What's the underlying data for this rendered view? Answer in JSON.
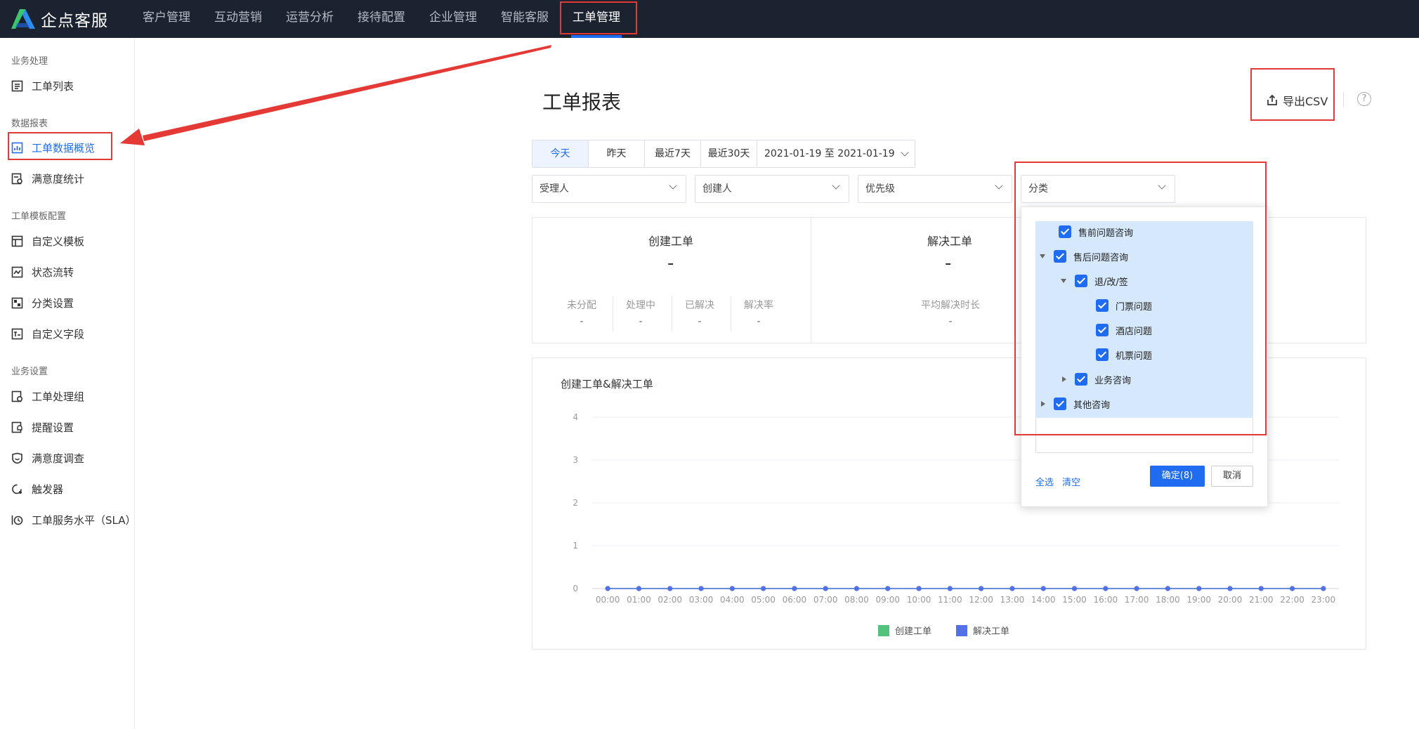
{
  "app": {
    "name": "企点客服"
  },
  "nav": [
    {
      "label": "客户管理",
      "active": false
    },
    {
      "label": "互动营销",
      "active": false
    },
    {
      "label": "运营分析",
      "active": false
    },
    {
      "label": "接待配置",
      "active": false
    },
    {
      "label": "企业管理",
      "active": false
    },
    {
      "label": "智能客服",
      "active": false
    },
    {
      "label": "工单管理",
      "active": true
    }
  ],
  "sidebar": {
    "groups": [
      {
        "title": "业务处理",
        "items": [
          {
            "label": "工单列表",
            "icon": "list-icon"
          }
        ]
      },
      {
        "title": "数据报表",
        "items": [
          {
            "label": "工单数据概览",
            "icon": "chart-icon",
            "active": true
          },
          {
            "label": "满意度统计",
            "icon": "survey-icon"
          }
        ]
      },
      {
        "title": "工单模板配置",
        "items": [
          {
            "label": "自定义模板",
            "icon": "template-icon"
          },
          {
            "label": "状态流转",
            "icon": "flow-icon"
          },
          {
            "label": "分类设置",
            "icon": "category-icon"
          },
          {
            "label": "自定义字段",
            "icon": "field-icon"
          }
        ]
      },
      {
        "title": "业务设置",
        "items": [
          {
            "label": "工单处理组",
            "icon": "group-icon"
          },
          {
            "label": "提醒设置",
            "icon": "reminder-icon"
          },
          {
            "label": "满意度调查",
            "icon": "satisfaction-icon"
          },
          {
            "label": "触发器",
            "icon": "trigger-icon"
          },
          {
            "label": "工单服务水平（SLA）",
            "icon": "sla-icon"
          }
        ]
      }
    ]
  },
  "main": {
    "title": "工单报表",
    "export_label": "导出CSV",
    "help_label": "?",
    "date_buttons": [
      {
        "label": "今天",
        "active": true
      },
      {
        "label": "昨天"
      },
      {
        "label": "最近7天"
      },
      {
        "label": "最近30天"
      }
    ],
    "date_range": "2021-01-19 至 2021-01-19",
    "filters": [
      {
        "placeholder": "受理人"
      },
      {
        "placeholder": "创建人"
      },
      {
        "placeholder": "优先级"
      },
      {
        "placeholder": "分类"
      }
    ],
    "stats": {
      "created": {
        "title": "创建工单",
        "value": "-",
        "subs": [
          {
            "label": "未分配",
            "value": "-"
          },
          {
            "label": "处理中",
            "value": "-"
          },
          {
            "label": "已解决",
            "value": "-"
          },
          {
            "label": "解决率",
            "value": "-"
          }
        ]
      },
      "resolved": {
        "title": "解决工单",
        "value": "-",
        "subs": [
          {
            "label": "平均解决时长",
            "value": "-"
          }
        ]
      }
    }
  },
  "chart_data": {
    "type": "line",
    "title": "创建工单&解决工单",
    "x": [
      "00:00",
      "01:00",
      "02:00",
      "03:00",
      "04:00",
      "05:00",
      "06:00",
      "07:00",
      "08:00",
      "09:00",
      "10:00",
      "11:00",
      "12:00",
      "13:00",
      "14:00",
      "15:00",
      "16:00",
      "17:00",
      "18:00",
      "19:00",
      "20:00",
      "21:00",
      "22:00",
      "23:00"
    ],
    "y_ticks": [
      0,
      1,
      2,
      3,
      4
    ],
    "ylim": [
      0,
      4
    ],
    "grid": true,
    "legend_position": "bottom",
    "series": [
      {
        "name": "创建工单",
        "color": "#52c27c",
        "values": [
          0,
          0,
          0,
          0,
          0,
          0,
          0,
          0,
          0,
          0,
          0,
          0,
          0,
          0,
          0,
          0,
          0,
          0,
          0,
          0,
          0,
          0,
          0,
          0
        ]
      },
      {
        "name": "解决工单",
        "color": "#5470e6",
        "values": [
          0,
          0,
          0,
          0,
          0,
          0,
          0,
          0,
          0,
          0,
          0,
          0,
          0,
          0,
          0,
          0,
          0,
          0,
          0,
          0,
          0,
          0,
          0,
          0
        ]
      }
    ]
  },
  "dropdown": {
    "tree": [
      {
        "label": "售前问题咨询",
        "depth": 0,
        "caret": "none"
      },
      {
        "label": "售后问题咨询",
        "depth": 0,
        "caret": "down"
      },
      {
        "label": "退/改/签",
        "depth": 1,
        "caret": "down"
      },
      {
        "label": "门票问题",
        "depth": 2,
        "caret": "none"
      },
      {
        "label": "酒店问题",
        "depth": 2,
        "caret": "none"
      },
      {
        "label": "机票问题",
        "depth": 2,
        "caret": "none"
      },
      {
        "label": "业务咨询",
        "depth": 1,
        "caret": "right"
      },
      {
        "label": "其他咨询",
        "depth": 0,
        "caret": "right"
      }
    ],
    "select_all": "全选",
    "clear": "清空",
    "confirm": "确定(8)",
    "cancel": "取消"
  },
  "colors": {
    "accent": "#1f6cf0",
    "topbar": "#1c2330",
    "annotation": "#e53935"
  }
}
